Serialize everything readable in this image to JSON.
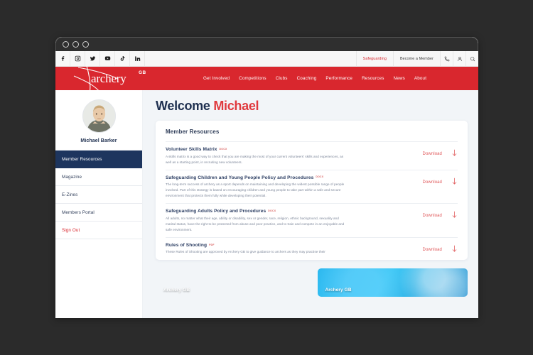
{
  "window": {
    "traffic_lights": [
      "close",
      "minimize",
      "maximize"
    ]
  },
  "topbar": {
    "social": [
      {
        "name": "facebook-icon",
        "label": "Facebook"
      },
      {
        "name": "instagram-icon",
        "label": "Instagram"
      },
      {
        "name": "twitter-icon",
        "label": "Twitter"
      },
      {
        "name": "youtube-icon",
        "label": "YouTube"
      },
      {
        "name": "tiktok-icon",
        "label": "TikTok"
      },
      {
        "name": "linkedin-icon",
        "label": "LinkedIn"
      }
    ],
    "safeguarding": "Safeguarding",
    "become_member": "Become a Member",
    "icons": [
      "phone-icon",
      "account-icon",
      "search-icon"
    ],
    "accent_red": "#d9272e"
  },
  "header": {
    "logo_text": "archery",
    "logo_superscript": "GB",
    "brand_red": "#d9272e",
    "nav": [
      {
        "label": "Get Involved"
      },
      {
        "label": "Competitions"
      },
      {
        "label": "Clubs"
      },
      {
        "label": "Coaching"
      },
      {
        "label": "Performance"
      },
      {
        "label": "Resources"
      },
      {
        "label": "News"
      },
      {
        "label": "About"
      }
    ]
  },
  "sidebar": {
    "member_name": "Michael Barker",
    "items": [
      {
        "label": "Member Resources",
        "active": true
      },
      {
        "label": "Magazine",
        "active": false
      },
      {
        "label": "E-Zines",
        "active": false
      },
      {
        "label": "Members Portal",
        "active": false
      },
      {
        "label": "Sign Out",
        "active": false,
        "style": "signout"
      }
    ],
    "active_color": "#1d355e",
    "signout_color": "#d9272e"
  },
  "main": {
    "welcome_prefix": "Welcome ",
    "welcome_name": "Michael",
    "card_title": "Member Resources",
    "download_label": "Download",
    "resources": [
      {
        "title": "Volunteer Skills Matrix",
        "badge": "DOCX",
        "description": "A skills matrix is a good way to check that you are making the most of your current volunteers' skills and experiences, as well as a starting point, in recruiting new volunteers.",
        "download": "Download"
      },
      {
        "title": "Safeguarding Children and Young People Policy and Procedures",
        "badge": "DOCX",
        "description": "The long-term success of archery as a sport depends on maintaining and developing the widest possible range of people involved. Part of this strategy is based on encouraging children and young people to take part within a safe and secure environment that protects them fully while developing their potential.",
        "download": "Download"
      },
      {
        "title": "Safeguarding Adults Policy and Procedures",
        "badge": "DOCX",
        "description": "All adults, no matter what their age, ability or disability, sex or gender, race, religion, ethnic background, sexuality and marital status, have the right to be protected from abuse and poor practice, and to train and compete in an enjoyable and safe environment.",
        "download": "Download"
      },
      {
        "title": "Rules of Shooting",
        "badge": "PDF",
        "description": "These Rules of Shooting are approved by Archery GB to give guidance to archers as they may practise their",
        "download": "Download"
      }
    ],
    "promos": [
      {
        "label": "Archery GB",
        "theme": "dark-navy"
      },
      {
        "label": "Archery GB",
        "theme": "cyan"
      }
    ]
  }
}
